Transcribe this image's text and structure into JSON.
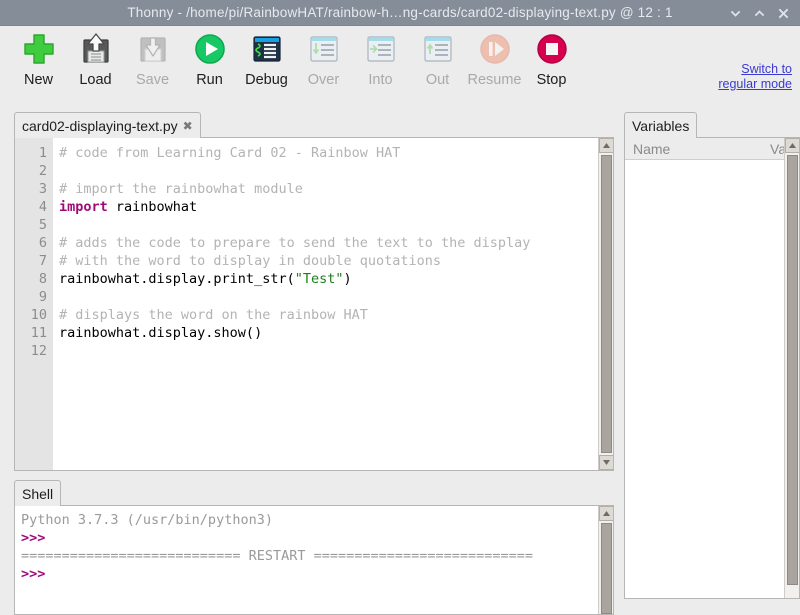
{
  "window": {
    "title": "Thonny  -  /home/pi/RainbowHAT/rainbow-h…ng-cards/card02-displaying-text.py  @  12 : 1",
    "app_name": "Thonny",
    "file_path": "/home/pi/RainbowHAT/rainbow-h…ng-cards/card02-displaying-text.py",
    "cursor_position": "12 : 1",
    "titlebar_color": "#848d98",
    "controls": {
      "minimize": "minimize-icon",
      "maximize": "maximize-icon",
      "close": "close-icon"
    }
  },
  "toolbar": {
    "buttons": [
      {
        "label": "New",
        "icon": "new-file-icon",
        "enabled": true
      },
      {
        "label": "Load",
        "icon": "load-file-icon",
        "enabled": true
      },
      {
        "label": "Save",
        "icon": "save-file-icon",
        "enabled": false
      },
      {
        "label": "Run",
        "icon": "run-icon",
        "enabled": true
      },
      {
        "label": "Debug",
        "icon": "debug-icon",
        "enabled": true
      },
      {
        "label": "Over",
        "icon": "step-over-icon",
        "enabled": false
      },
      {
        "label": "Into",
        "icon": "step-into-icon",
        "enabled": false
      },
      {
        "label": "Out",
        "icon": "step-out-icon",
        "enabled": false
      },
      {
        "label": "Resume",
        "icon": "resume-icon",
        "enabled": false
      },
      {
        "label": "Stop",
        "icon": "stop-icon",
        "enabled": true
      }
    ],
    "switch_link_line1": "Switch to",
    "switch_link_line2": "regular mode",
    "link_color": "#3a3ad0"
  },
  "editor": {
    "tab_label": "card02-displaying-text.py",
    "tab_close": "✖",
    "line_numbers": [
      "1",
      "2",
      "3",
      "4",
      "5",
      "6",
      "7",
      "8",
      "9",
      "10",
      "11",
      "12"
    ],
    "lines": [
      {
        "n": "1",
        "segments": [
          {
            "t": "# code from Learning Card 02 - Rainbow HAT",
            "c": "cm"
          }
        ]
      },
      {
        "n": "2",
        "segments": [
          {
            "t": "",
            "c": ""
          }
        ]
      },
      {
        "n": "3",
        "segments": [
          {
            "t": "# import the rainbowhat module",
            "c": "cm"
          }
        ]
      },
      {
        "n": "4",
        "segments": [
          {
            "t": "import",
            "c": "kw"
          },
          {
            "t": " rainbowhat",
            "c": ""
          }
        ]
      },
      {
        "n": "5",
        "segments": [
          {
            "t": "",
            "c": ""
          }
        ]
      },
      {
        "n": "6",
        "segments": [
          {
            "t": "# adds the code to prepare to send the text to the display",
            "c": "cm"
          }
        ]
      },
      {
        "n": "7",
        "segments": [
          {
            "t": "# with the word to display in double quotations",
            "c": "cm"
          }
        ]
      },
      {
        "n": "8",
        "segments": [
          {
            "t": "rainbowhat.display.print_str(",
            "c": ""
          },
          {
            "t": "\"Test\"",
            "c": "st"
          },
          {
            "t": ")",
            "c": ""
          }
        ]
      },
      {
        "n": "9",
        "segments": [
          {
            "t": "",
            "c": ""
          }
        ]
      },
      {
        "n": "10",
        "segments": [
          {
            "t": "# displays the word on the rainbow HAT",
            "c": "cm"
          }
        ]
      },
      {
        "n": "11",
        "segments": [
          {
            "t": "rainbowhat.display.show()",
            "c": ""
          }
        ]
      },
      {
        "n": "12",
        "segments": [
          {
            "t": "",
            "c": ""
          }
        ]
      }
    ]
  },
  "variables": {
    "tab_label": "Variables",
    "columns": [
      "Name",
      "Valu"
    ],
    "rows": []
  },
  "shell": {
    "tab_label": "Shell",
    "lines": [
      {
        "t": "Python 3.7.3 (/usr/bin/python3)",
        "c": ""
      },
      {
        "t": ">>> ",
        "c": "prompt"
      },
      {
        "t": "=========================== RESTART ===========================",
        "c": ""
      },
      {
        "t": ">>> ",
        "c": "prompt"
      }
    ]
  }
}
